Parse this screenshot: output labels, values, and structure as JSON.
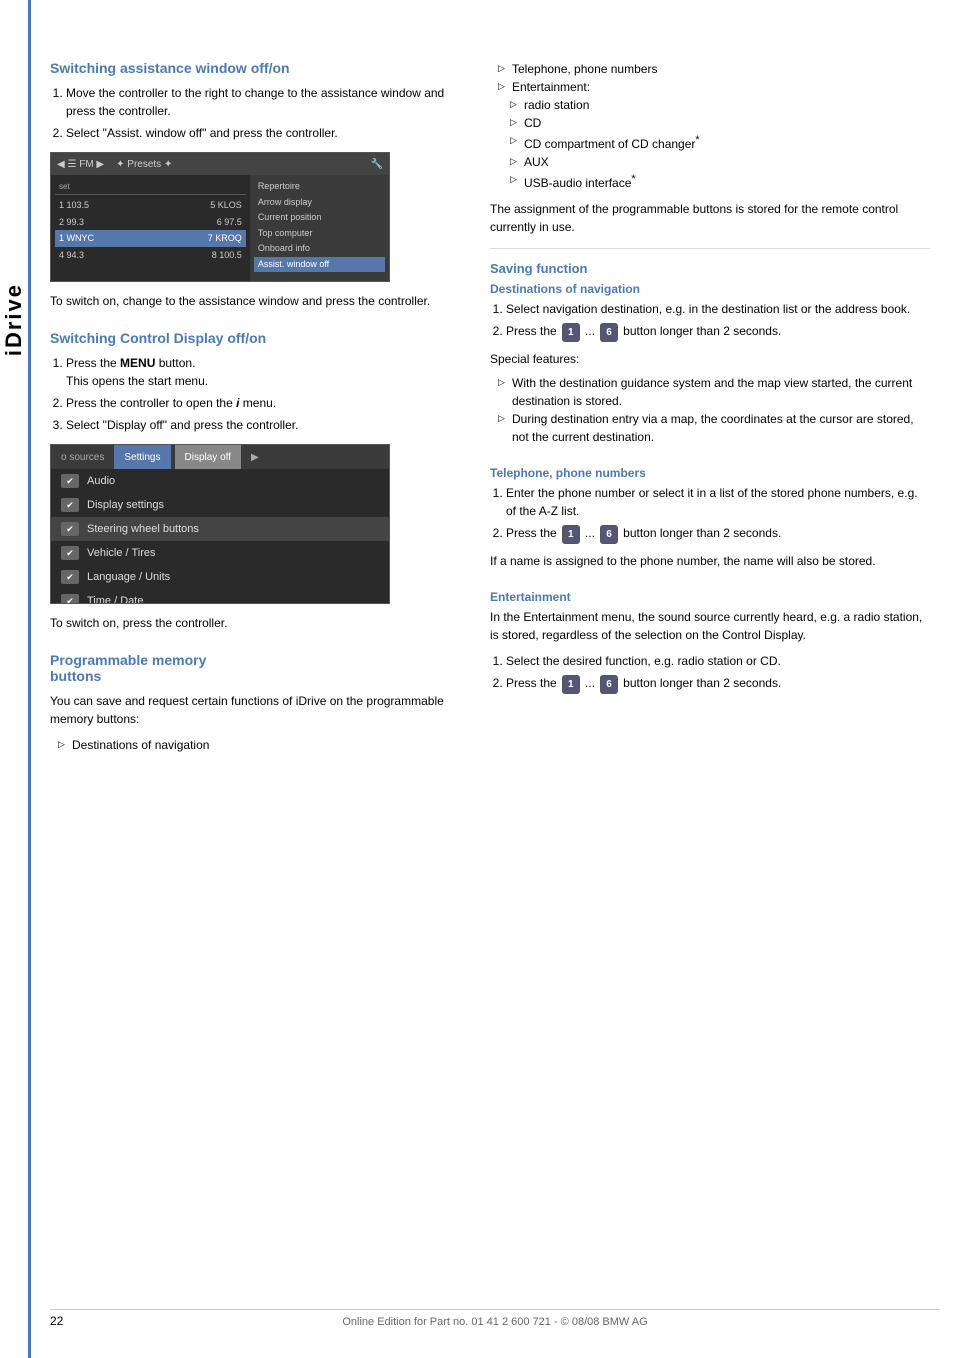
{
  "page": {
    "number": "22",
    "footnote": "Online Edition for Part no. 01 41 2 600 721 - © 08/08 BMW AG"
  },
  "side_tab": {
    "label": "iDrive"
  },
  "left_column": {
    "section1": {
      "title": "Switching assistance window off/on",
      "steps": [
        "Move the controller to the right to change to the assistance window and press the controller.",
        "Select \"Assist. window off\" and press the controller."
      ],
      "after_text": "To switch on, change to the assistance window and press the controller."
    },
    "section2": {
      "title": "Switching Control Display off/on",
      "steps": [
        "Press the MENU button.\nThis opens the start menu.",
        "Press the controller to open the i menu.",
        "Select \"Display off\" and press the controller."
      ],
      "after_text": "To switch on, press the controller."
    },
    "section3": {
      "title": "Programmable memory buttons",
      "intro": "You can save and request certain functions of iDrive on the programmable memory buttons:",
      "bullets": [
        "Destinations of navigation"
      ]
    },
    "screen1": {
      "top_bar": {
        "left": "FM",
        "presets": "Presets",
        "icon": "◀"
      },
      "set_row": "set",
      "freq_rows": [
        {
          "left": "1 103.5",
          "right": "5 KLOS"
        },
        {
          "left": "2 99.3",
          "right": "6 97.5"
        },
        {
          "left": "1 WNYC",
          "right": "7 KROQ"
        },
        {
          "left": "4 94.3",
          "right": "8 100.5"
        }
      ],
      "menu_items": [
        "Repertoire",
        "Arrow display",
        "Current position",
        "Top computer",
        "Onboard info",
        "Assist. window off"
      ]
    },
    "screen2": {
      "tabs": [
        "o sources",
        "Settings",
        "Display off",
        "▶"
      ],
      "active_tab": "Settings",
      "items": [
        {
          "icon": "✔",
          "label": "Audio"
        },
        {
          "icon": "✔",
          "label": "Display settings"
        },
        {
          "icon": "✔",
          "label": "Steering wheel buttons"
        },
        {
          "icon": "✔",
          "label": "Vehicle / Tires"
        },
        {
          "icon": "✔",
          "label": "Language / Units"
        },
        {
          "icon": "✔",
          "label": "Time / Date"
        }
      ]
    }
  },
  "right_column": {
    "bullets_cont": [
      "Telephone, phone numbers",
      "Entertainment:",
      "radio station",
      "CD",
      "CD compartment of CD changer*",
      "AUX",
      "USB-audio interface*"
    ],
    "after_bullets": "The assignment of the programmable buttons is stored for the remote control currently in use.",
    "saving_function": {
      "title": "Saving function",
      "destinations": {
        "subtitle": "Destinations of navigation",
        "steps": [
          "Select navigation destination, e.g. in the destination list or the address book.",
          "Press the  1  ...  6  button longer than 2 seconds."
        ],
        "special_features_label": "Special features:",
        "special_bullets": [
          "With the destination guidance system and the map view started, the current destination is stored.",
          "During destination entry via a map, the coordinates at the cursor are stored, not the current destination."
        ]
      },
      "telephone": {
        "subtitle": "Telephone, phone numbers",
        "steps": [
          "Enter the phone number or select it in a list of the stored phone numbers, e.g. of the A-Z list.",
          "Press the  1  ...  6  button longer than 2 seconds."
        ],
        "after": "If a name is assigned to the phone number, the name will also be stored."
      },
      "entertainment": {
        "subtitle": "Entertainment",
        "intro": "In the Entertainment menu, the sound source currently heard, e.g. a radio station, is stored, regardless of the selection on the Control Display.",
        "steps": [
          "Select the desired function, e.g. radio station or CD.",
          "Press the  1  ...  6  button longer than 2 seconds."
        ]
      }
    }
  }
}
